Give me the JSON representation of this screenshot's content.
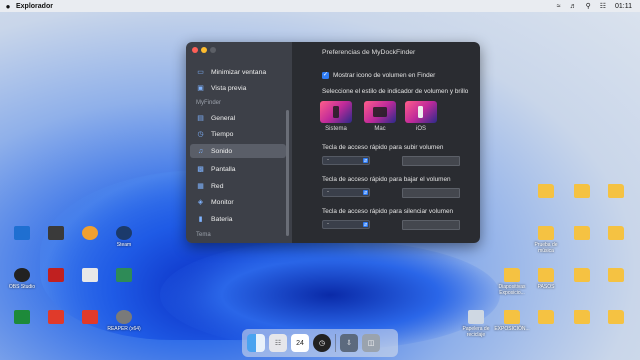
{
  "menubar": {
    "app_name": "Explorador",
    "clock": "01:11"
  },
  "window": {
    "title": "Preferencias de MyDockFinder",
    "sidebar": {
      "top_items": [
        {
          "label": "Minimizar ventana",
          "icon": "minimize-icon"
        },
        {
          "label": "Vista previa",
          "icon": "preview-icon"
        }
      ],
      "section_myfinder": "MyFinder",
      "items": [
        {
          "label": "General",
          "icon": "general-icon"
        },
        {
          "label": "Tiempo",
          "icon": "clock-icon"
        },
        {
          "label": "Sonido",
          "icon": "speaker-icon",
          "active": true
        },
        {
          "label": "Pantalla",
          "icon": "display-icon"
        },
        {
          "label": "Red",
          "icon": "network-icon"
        },
        {
          "label": "Monitor",
          "icon": "monitor-icon"
        },
        {
          "label": "Bateria",
          "icon": "battery-icon"
        }
      ],
      "section_tema": "Tema"
    },
    "main": {
      "show_volume_icon": "Mostrar icono de volumen en Finder",
      "style_prompt": "Seleccione el estilo de indicador de volumen y brillo",
      "styles": [
        "Sistema",
        "Mac",
        "iOS"
      ],
      "volume_up_label": "Tecla de acceso rápido para subir volumen",
      "volume_down_label": "Tecla de acceso rápido para bajar el volumen",
      "mute_label": "Tecla de acceso rápido para silenciar volumen",
      "select_value": "-"
    }
  },
  "desktop_icons": [
    {
      "label": "Steam",
      "kind": "app"
    },
    {
      "label": "Prueba de música",
      "kind": "folder"
    },
    {
      "label": "Diapositivas Exposicio...",
      "kind": "folder"
    },
    {
      "label": "PASOS",
      "kind": "folder"
    },
    {
      "label": "Papelera de reciclaje",
      "kind": "trash"
    },
    {
      "label": "EXPOSICIÓN...",
      "kind": "folder"
    },
    {
      "label": "OBS Studio",
      "kind": "app"
    },
    {
      "label": "REAPER (x64)",
      "kind": "app"
    }
  ],
  "dock": [
    "finder-icon",
    "launchpad-icon",
    "calendar-icon",
    "clock-icon",
    "downloads-icon",
    "trash-icon"
  ],
  "calendar_day": "24"
}
